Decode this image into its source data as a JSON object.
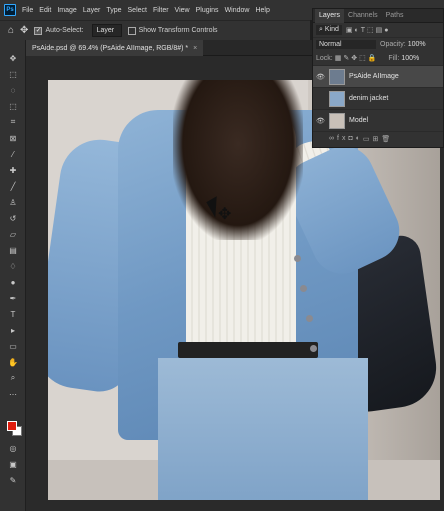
{
  "menu": {
    "logo": "Ps",
    "items": [
      "File",
      "Edit",
      "Image",
      "Layer",
      "Type",
      "Select",
      "Filter",
      "View",
      "Plugins",
      "Window",
      "Help"
    ]
  },
  "options": {
    "auto_select_label": "Auto-Select:",
    "auto_select_value": "Layer",
    "transform_label": "Show Transform Controls"
  },
  "document": {
    "tab_title": "PsAide.psd @ 69.4% (PsAide AIImage, RGB/8#) *",
    "close": "×"
  },
  "layers_panel": {
    "tabs": [
      "Layers",
      "Channels",
      "Paths"
    ],
    "kind": "Kind",
    "blend_mode": "Normal",
    "opacity_label": "Opacity:",
    "opacity_value": "100%",
    "lock_label": "Lock:",
    "fill_label": "Fill:",
    "fill_value": "100%",
    "layers": [
      {
        "name": "PsAide AIImage"
      },
      {
        "name": "denim jacket"
      },
      {
        "name": "Model"
      }
    ]
  },
  "colors": {
    "foreground": "#e11d0f",
    "background": "#ffffff"
  }
}
